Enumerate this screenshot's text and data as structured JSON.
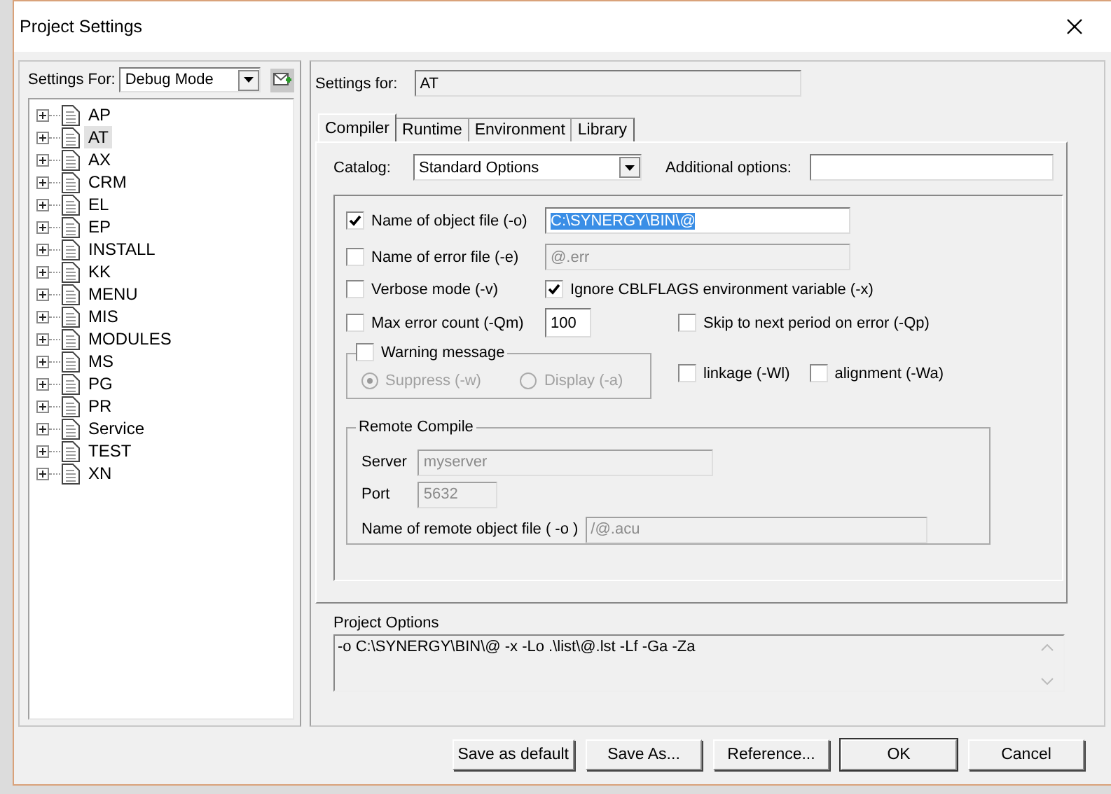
{
  "window": {
    "title": "Project Settings"
  },
  "sidebar": {
    "settings_for": {
      "label": "Settings For:",
      "value": "Debug Mode"
    },
    "items": [
      {
        "label": "AP",
        "selected": false,
        "expanded": false
      },
      {
        "label": "AT",
        "selected": true,
        "expanded": false
      },
      {
        "label": "AX",
        "selected": false,
        "expanded": false
      },
      {
        "label": "CRM",
        "selected": false,
        "expanded": false
      },
      {
        "label": "EL",
        "selected": false,
        "expanded": false
      },
      {
        "label": "EP",
        "selected": false,
        "expanded": false
      },
      {
        "label": "INSTALL",
        "selected": false,
        "expanded": false
      },
      {
        "label": "KK",
        "selected": false,
        "expanded": false
      },
      {
        "label": "MENU",
        "selected": false,
        "expanded": false
      },
      {
        "label": "MIS",
        "selected": false,
        "expanded": false
      },
      {
        "label": "MODULES",
        "selected": false,
        "expanded": false
      },
      {
        "label": "MS",
        "selected": false,
        "expanded": false
      },
      {
        "label": "PG",
        "selected": false,
        "expanded": false
      },
      {
        "label": "PR",
        "selected": false,
        "expanded": false
      },
      {
        "label": "Service",
        "selected": false,
        "expanded": false
      },
      {
        "label": "TEST",
        "selected": false,
        "expanded": false
      },
      {
        "label": "XN",
        "selected": false,
        "expanded": false
      }
    ]
  },
  "settings_for": {
    "label": "Settings for:",
    "value": "AT"
  },
  "tabs": [
    {
      "label": "Compiler",
      "selected": true
    },
    {
      "label": "Runtime",
      "selected": false
    },
    {
      "label": "Environment",
      "selected": false
    },
    {
      "label": "Library",
      "selected": false
    }
  ],
  "catalog": {
    "label": "Catalog:",
    "value": "Standard Options"
  },
  "additional_options": {
    "label": "Additional options:"
  },
  "object_file": {
    "label": "Name of object file (-o)",
    "checked": true,
    "value": "C:\\SYNERGY\\BIN\\@",
    "highlighted": true,
    "disabled": false
  },
  "error_file": {
    "label": "Name of error file (-e)",
    "checked": false,
    "value": "@.err",
    "highlighted": false,
    "disabled": true
  },
  "verbose": {
    "label": "Verbose mode (-v)",
    "checked": false
  },
  "ignore_cblflags": {
    "label": "Ignore CBLFLAGS environment variable (-x)",
    "checked": true
  },
  "max_error": {
    "label": "Max error count (-Qm)",
    "checked": false,
    "value": "100"
  },
  "skip_period": {
    "label": "Skip to next period on error (-Qp)",
    "checked": false
  },
  "warning": {
    "label": "Warning message",
    "checked": false,
    "options": [
      {
        "label": "Suppress (-w)",
        "selected": true,
        "disabled": true
      },
      {
        "label": "Display (-a)",
        "selected": false,
        "disabled": true
      }
    ]
  },
  "linkage": {
    "label": "linkage (-Wl)",
    "checked": false
  },
  "alignment": {
    "label": "alignment (-Wa)",
    "checked": false
  },
  "remote_compile": {
    "title": "Remote Compile",
    "server": {
      "label": "Server",
      "value": "myserver",
      "disabled": true
    },
    "port": {
      "label": "Port",
      "value": "5632",
      "disabled": true
    },
    "object_file": {
      "label": "Name of remote object file ( -o )",
      "value": "/@.acu",
      "disabled": true
    }
  },
  "project_options": {
    "label": "Project Options",
    "value": "-o C:\\SYNERGY\\BIN\\@ -x -Lo .\\list\\@.lst -Lf -Ga -Za"
  },
  "buttons": [
    {
      "label": "Save as default",
      "default": false
    },
    {
      "label": "Save As...",
      "default": false
    },
    {
      "label": "Reference...",
      "default": false
    },
    {
      "label": "OK",
      "default": true
    },
    {
      "label": "Cancel",
      "default": false
    }
  ]
}
